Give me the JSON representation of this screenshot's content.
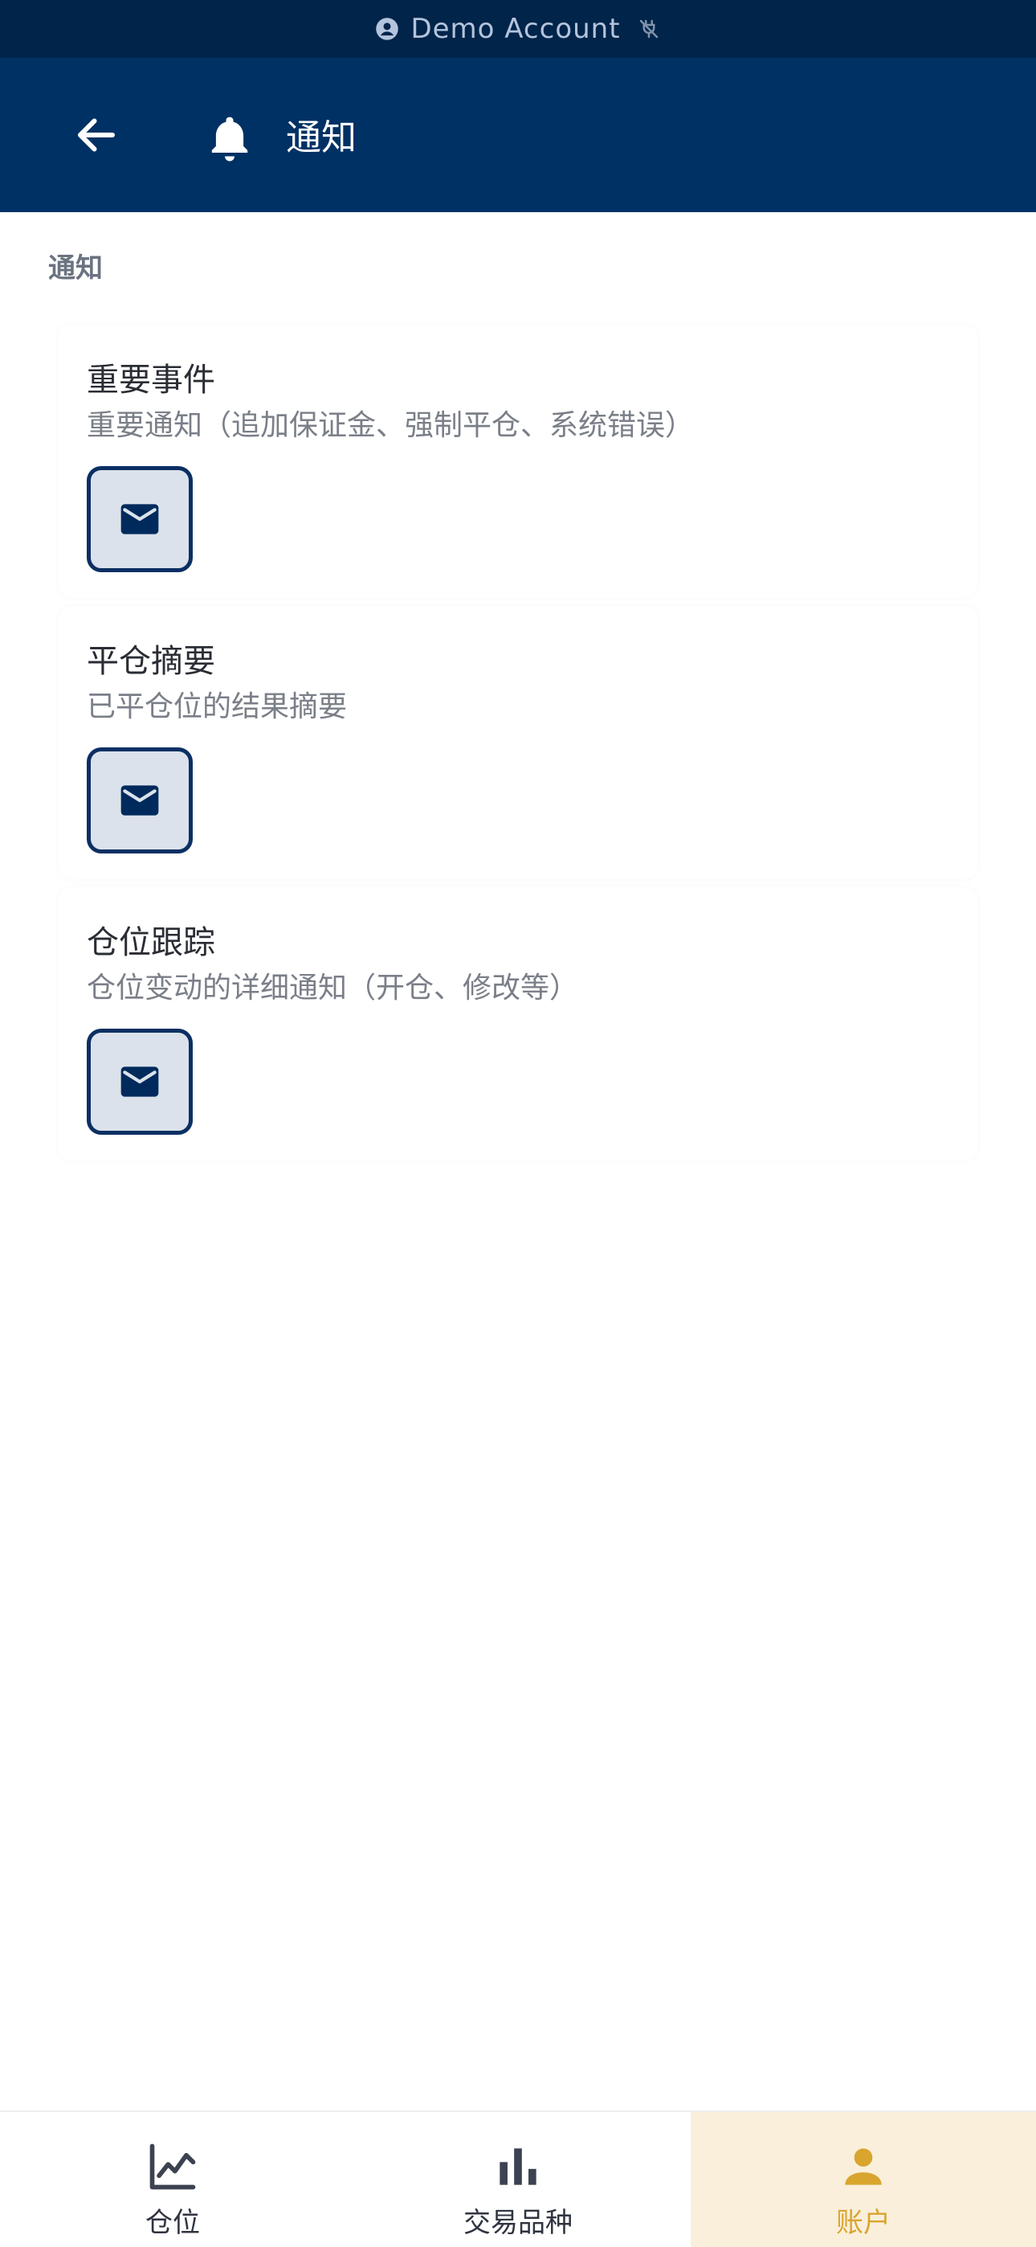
{
  "colors": {
    "account_bar_bg": "#00244a",
    "header_bg": "#003164",
    "accent_gold": "#d9a52e",
    "mail_button_border": "#0b2f63",
    "mail_button_fill": "#dbe2eb"
  },
  "account_bar": {
    "label": "Demo Account",
    "icons": [
      "account-circle-icon",
      "connection-off-icon"
    ]
  },
  "header": {
    "back_icon": "arrow-left-icon",
    "title_icon": "bell-icon",
    "title": "通知"
  },
  "section": {
    "label": "通知"
  },
  "notifications": [
    {
      "title": "重要事件",
      "description": "重要通知（追加保证金、强制平仓、系统错误）",
      "channel_icon": "mail-icon"
    },
    {
      "title": "平仓摘要",
      "description": "已平仓位的结果摘要",
      "channel_icon": "mail-icon"
    },
    {
      "title": "仓位跟踪",
      "description": "仓位变动的详细通知（开仓、修改等）",
      "channel_icon": "mail-icon"
    }
  ],
  "bottom_nav": {
    "items": [
      {
        "label": "仓位",
        "icon": "line-chart-icon",
        "active": false
      },
      {
        "label": "交易品种",
        "icon": "bar-chart-icon",
        "active": false
      },
      {
        "label": "账户",
        "icon": "person-icon",
        "active": true
      }
    ]
  }
}
